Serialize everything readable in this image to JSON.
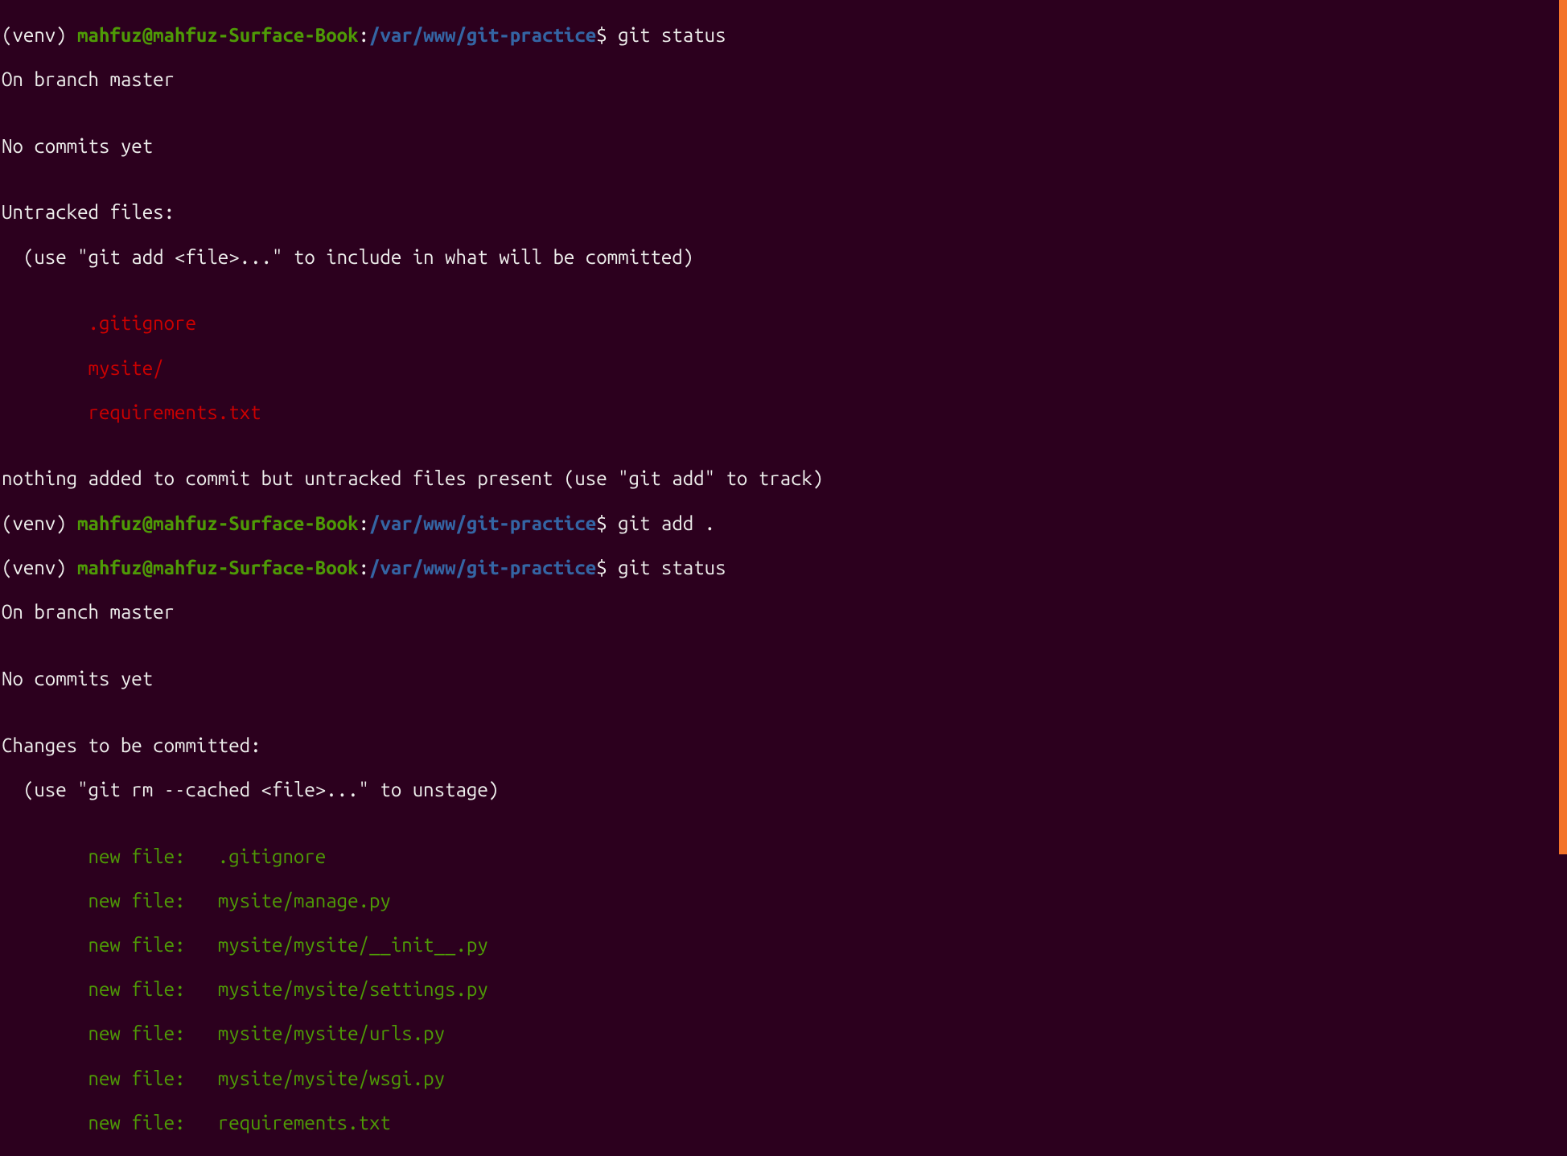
{
  "colors": {
    "background": "#2c001e",
    "text": "#eeeeec",
    "green": "#4e9a06",
    "blue": "#3465a4",
    "red": "#cc0000",
    "scrollbar": "#f37329"
  },
  "prompt": {
    "venv": "(venv) ",
    "user_host": "mahfuz@mahfuz-Surface-Book",
    "colon": ":",
    "path": "/var/www/git-practice",
    "dollar": "$ "
  },
  "commands": {
    "cmd1": "git status",
    "cmd2": "git add .",
    "cmd3": "git status"
  },
  "output1": {
    "branch": "On branch master",
    "blank1": "",
    "no_commits": "No commits yet",
    "blank2": "",
    "untracked_header": "Untracked files:",
    "untracked_hint": "  (use \"git add <file>...\" to include in what will be committed)",
    "blank3": "",
    "file1": "        .gitignore",
    "file2": "        mysite/",
    "file3": "        requirements.txt",
    "blank4": "",
    "nothing_added": "nothing added to commit but untracked files present (use \"git add\" to track)"
  },
  "output3": {
    "branch": "On branch master",
    "blank1": "",
    "no_commits": "No commits yet",
    "blank2": "",
    "changes_header": "Changes to be committed:",
    "changes_hint": "  (use \"git rm --cached <file>...\" to unstage)",
    "blank3": "",
    "file1": "        new file:   .gitignore",
    "file2": "        new file:   mysite/manage.py",
    "file3": "        new file:   mysite/mysite/__init__.py",
    "file4": "        new file:   mysite/mysite/settings.py",
    "file5": "        new file:   mysite/mysite/urls.py",
    "file6": "        new file:   mysite/mysite/wsgi.py",
    "file7": "        new file:   requirements.txt"
  }
}
